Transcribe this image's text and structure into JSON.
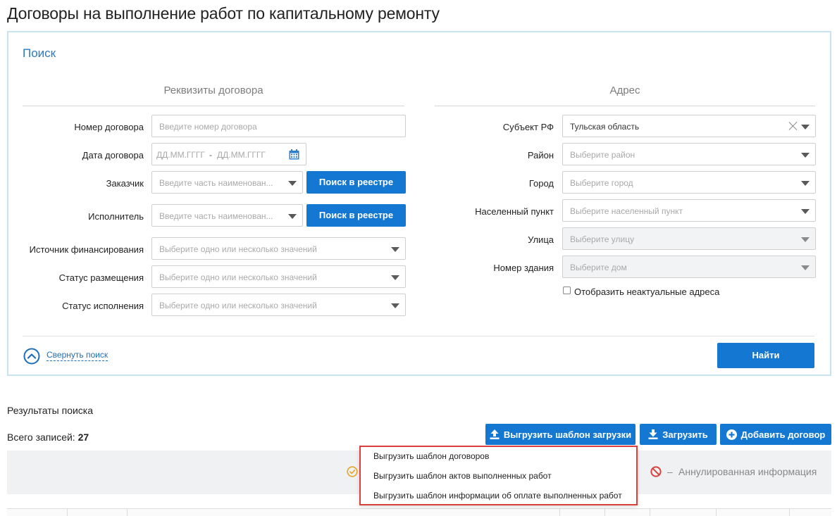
{
  "page": {
    "title": "Договоры на выполнение работ по капитальному ремонту"
  },
  "search": {
    "title": "Поиск",
    "contract_section": {
      "heading": "Реквизиты договора",
      "number": {
        "label": "Номер договора",
        "placeholder": "Введите номер договора"
      },
      "date": {
        "label": "Дата договора",
        "from_placeholder": "ДД.ММ.ГГГГ",
        "separator": "-",
        "to_placeholder": "ДД.ММ.ГГГГ"
      },
      "customer": {
        "label": "Заказчик",
        "placeholder": "Введите часть наименован...",
        "button": "Поиск в реестре"
      },
      "executor": {
        "label": "Исполнитель",
        "placeholder": "Введите часть наименован...",
        "button": "Поиск в реестре"
      },
      "funding_source": {
        "label": "Источник финансирования",
        "placeholder": "Выберите одно или несколько значений"
      },
      "placement_status": {
        "label": "Статус размещения",
        "placeholder": "Выберите одно или несколько значений"
      },
      "execution_status": {
        "label": "Статус исполнения",
        "placeholder": "Выберите одно или несколько значений"
      }
    },
    "address_section": {
      "heading": "Адрес",
      "subject": {
        "label": "Субъект РФ",
        "value": "Тульская область"
      },
      "district": {
        "label": "Район",
        "placeholder": "Выберите район"
      },
      "city": {
        "label": "Город",
        "placeholder": "Выберите город"
      },
      "settlement": {
        "label": "Населенный пункт",
        "placeholder": "Выберите населенный пункт"
      },
      "street": {
        "label": "Улица",
        "placeholder": "Выберите улицу"
      },
      "building": {
        "label": "Номер здания",
        "placeholder": "Выберите дом"
      },
      "show_outdated": {
        "label": "Отобразить неактуальные адреса",
        "checked": false
      }
    },
    "collapse_label": "Свернуть поиск",
    "find_button": "Найти"
  },
  "results": {
    "title": "Результаты поиска",
    "total_label": "Всего записей:",
    "total_count": "27",
    "buttons": {
      "export_template": "Выгрузить шаблон загрузки",
      "upload": "Загрузить",
      "add_contract": "Добавить договор"
    },
    "legend": {
      "dash": "–",
      "annulled": "Аннулированная информация"
    }
  },
  "export_menu": {
    "items": [
      "Выгрузить шаблон договоров",
      "Выгрузить шаблон актов выполненных работ",
      "Выгрузить шаблон информации об оплате выполненных работ"
    ]
  },
  "colors": {
    "accent": "#1478d2",
    "panel_border": "#c9e3ee",
    "highlight_border": "#d9413f",
    "warning_icon": "#e5a525",
    "cancel_icon": "#d9413f"
  }
}
